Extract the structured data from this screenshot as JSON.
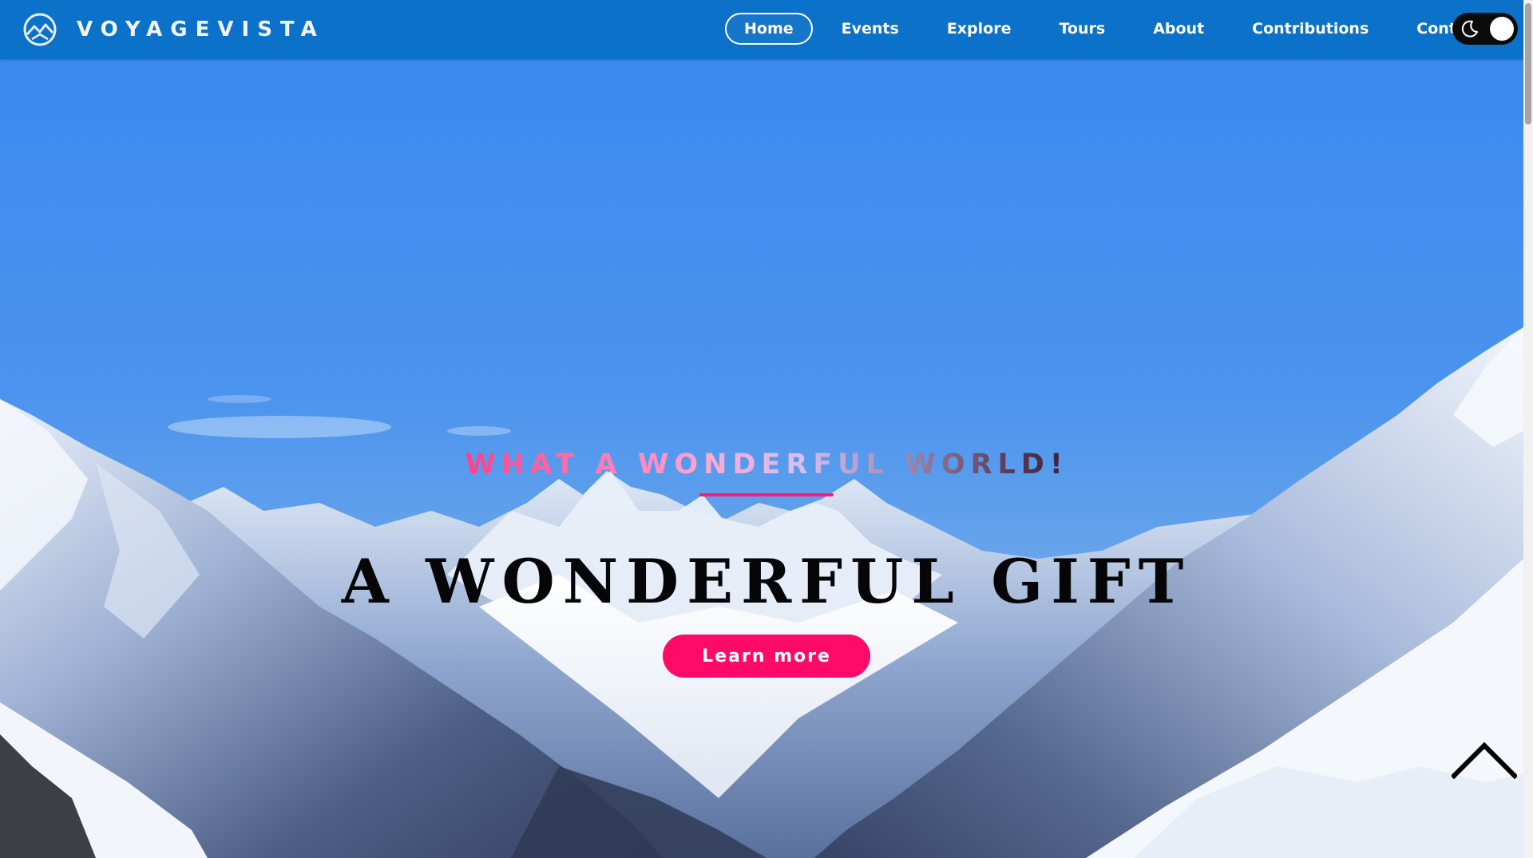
{
  "brand": {
    "name": "VOYAGEVISTA",
    "logo_icon": "mountain-sun-logo-icon"
  },
  "nav": {
    "items": [
      {
        "label": "Home",
        "active": true
      },
      {
        "label": "Events",
        "active": false
      },
      {
        "label": "Explore",
        "active": false
      },
      {
        "label": "Tours",
        "active": false
      },
      {
        "label": "About",
        "active": false
      },
      {
        "label": "Contributions",
        "active": false
      },
      {
        "label": "Contact",
        "active": false
      }
    ],
    "theme_toggle": {
      "icon": "moon-icon",
      "state": "light"
    }
  },
  "hero": {
    "tagline": "WHAT A WONDERFUL WORLD!",
    "headline": "A WONDERFUL GIFT",
    "cta_label": "Learn more",
    "background": "snow-mountain-landscape"
  },
  "scroll_top": {
    "icon": "chevron-up-icon"
  },
  "colors": {
    "navbar": "#0c71c8",
    "accent": "#ff0a67",
    "sky": "#3a85e8",
    "headline": "#060608"
  }
}
